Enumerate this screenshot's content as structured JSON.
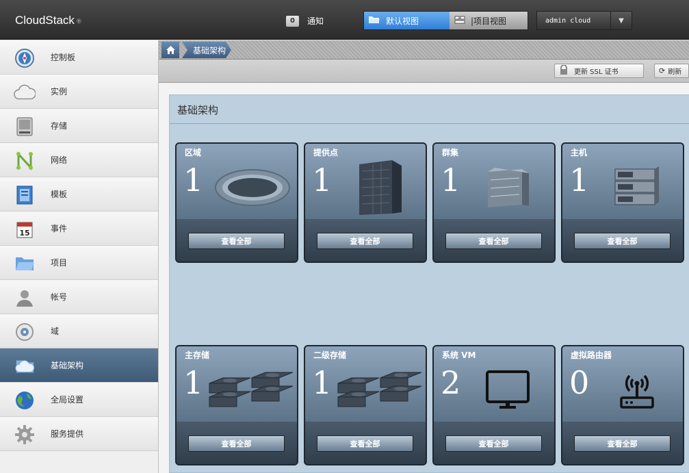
{
  "header": {
    "logo": "CloudStack",
    "notifications": {
      "count": "0",
      "label": "通知"
    },
    "views": {
      "default": "默认视图",
      "project": "|项目视图"
    },
    "user": "admin cloud"
  },
  "sidebar": {
    "items": [
      {
        "label": "控制板",
        "icon": "dashboard-compass-icon",
        "active": false
      },
      {
        "label": "实例",
        "icon": "cloud-icon",
        "active": false
      },
      {
        "label": "存储",
        "icon": "storage-drive-icon",
        "active": false
      },
      {
        "label": "网络",
        "icon": "network-icon",
        "active": false
      },
      {
        "label": "模板",
        "icon": "template-icon",
        "active": false
      },
      {
        "label": "事件",
        "icon": "calendar-icon",
        "active": false
      },
      {
        "label": "项目",
        "icon": "folder-icon",
        "active": false
      },
      {
        "label": "帐号",
        "icon": "user-icon",
        "active": false
      },
      {
        "label": "域",
        "icon": "domain-disc-icon",
        "active": false
      },
      {
        "label": "基础架构",
        "icon": "infrastructure-cloud-icon",
        "active": true
      },
      {
        "label": "全局设置",
        "icon": "globe-icon",
        "active": false
      },
      {
        "label": "服务提供",
        "icon": "gear-icon",
        "active": false
      }
    ]
  },
  "breadcrumb": {
    "current": "基础架构"
  },
  "toolbar": {
    "ssl": "更新 SSL 证书",
    "refresh": "刷新"
  },
  "panel": {
    "title": "基础架构",
    "view_all": "查看全部",
    "tiles": [
      {
        "name": "区域",
        "count": "1",
        "icon": "zone-ring-icon"
      },
      {
        "name": "提供点",
        "count": "1",
        "icon": "pod-rack-icon"
      },
      {
        "name": "群集",
        "count": "1",
        "icon": "cluster-box-icon"
      },
      {
        "name": "主机",
        "count": "1",
        "icon": "host-server-icon"
      },
      {
        "name": "主存储",
        "count": "1",
        "icon": "primary-storage-icon"
      },
      {
        "name": "二级存储",
        "count": "1",
        "icon": "secondary-storage-icon"
      },
      {
        "name": "系统 VM",
        "count": "2",
        "icon": "monitor-icon"
      },
      {
        "name": "虚拟路由器",
        "count": "0",
        "icon": "router-icon"
      }
    ]
  }
}
